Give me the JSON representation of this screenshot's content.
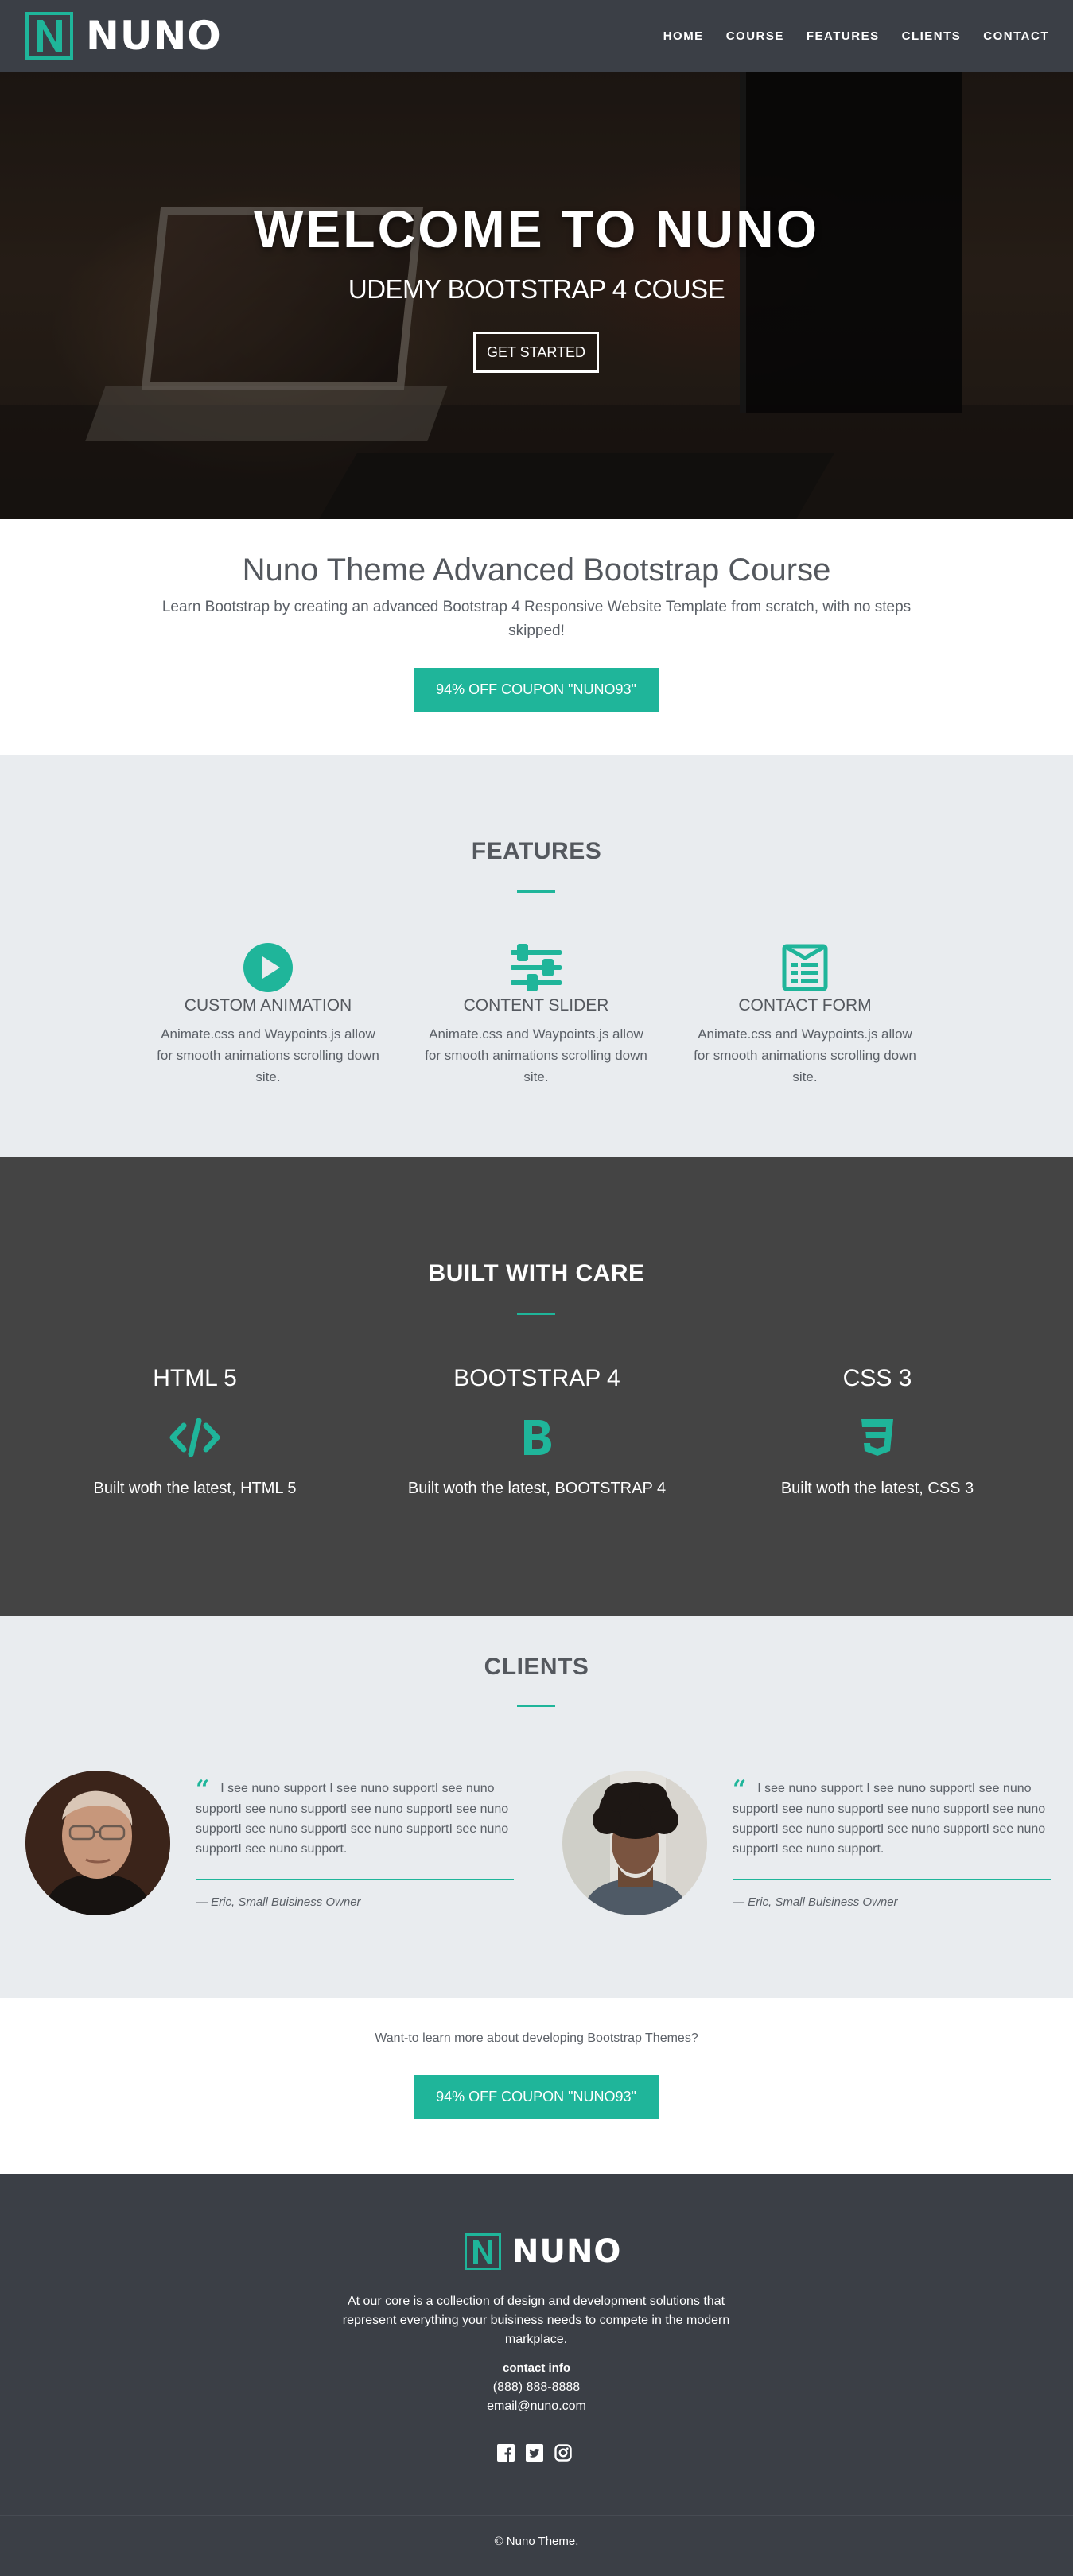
{
  "brand": {
    "name": "NUNO",
    "logo_letter": "N"
  },
  "nav": {
    "items": [
      "HOME",
      "COURSE",
      "FEATURES",
      "CLIENTS",
      "CONTACT"
    ]
  },
  "hero": {
    "title": "WELCOME TO NUNO",
    "subtitle": "UDEMY BOOTSTRAP 4 COUSE",
    "button": "GET STARTED"
  },
  "intro": {
    "title": "Nuno Theme Advanced Bootstrap Course",
    "text": "Learn Bootstrap by creating an advanced Bootstrap 4 Responsive Website Template from scratch, with no steps skipped!",
    "button": "94% OFF COUPON \"NUNO93\""
  },
  "features": {
    "title": "FEATURES",
    "items": [
      {
        "icon": "play-circle-icon",
        "title": "CUSTOM ANIMATION",
        "text": "Animate.css and Waypoints.js allow for smooth animations scrolling down site."
      },
      {
        "icon": "sliders-icon",
        "title": "CONTENT SLIDER",
        "text": "Animate.css and Waypoints.js allow for smooth animations scrolling down site."
      },
      {
        "icon": "form-icon",
        "title": "CONTACT FORM",
        "text": "Animate.css and Waypoints.js allow for smooth animations scrolling down site."
      }
    ]
  },
  "built": {
    "title": "BUILT WITH CARE",
    "items": [
      {
        "icon": "code-icon",
        "title": "HTML 5",
        "text": "Built woth the latest, HTML 5"
      },
      {
        "icon": "bootstrap-icon",
        "title": "BOOTSTRAP 4",
        "text": "Built woth the latest, BOOTSTRAP 4"
      },
      {
        "icon": "css3-icon",
        "title": "CSS 3",
        "text": "Built woth the latest, CSS 3"
      }
    ]
  },
  "clients": {
    "title": "CLIENTS",
    "items": [
      {
        "quote": "I see nuno support I see nuno supportI see nuno supportI see nuno supportI see nuno supportI see nuno supportI see nuno supportI see nuno supportI see nuno supportI see nuno support.",
        "author": "— Eric, Small Buisiness Owner"
      },
      {
        "quote": "I see nuno support I see nuno supportI see nuno supportI see nuno supportI see nuno supportI see nuno supportI see nuno supportI see nuno supportI see nuno supportI see nuno support.",
        "author": "— Eric, Small Buisiness Owner"
      }
    ]
  },
  "cta": {
    "text": "Want-to learn more about developing Bootstrap Themes?",
    "button": "94% OFF COUPON \"NUNO93\""
  },
  "footer": {
    "about": "At our core is a collection of design and development solutions that represent everything your buisiness needs to compete in the modern markplace.",
    "contact_heading": "contact info",
    "phone": "(888) 888-8888",
    "email": "email@nuno.com",
    "social": [
      "facebook-icon",
      "twitter-icon",
      "instagram-icon"
    ],
    "copyright": "© Nuno Theme."
  },
  "colors": {
    "accent": "#1fb59a",
    "dark": "#3b3f46",
    "built_bg": "#444444",
    "light_bg": "#e9ecef"
  }
}
